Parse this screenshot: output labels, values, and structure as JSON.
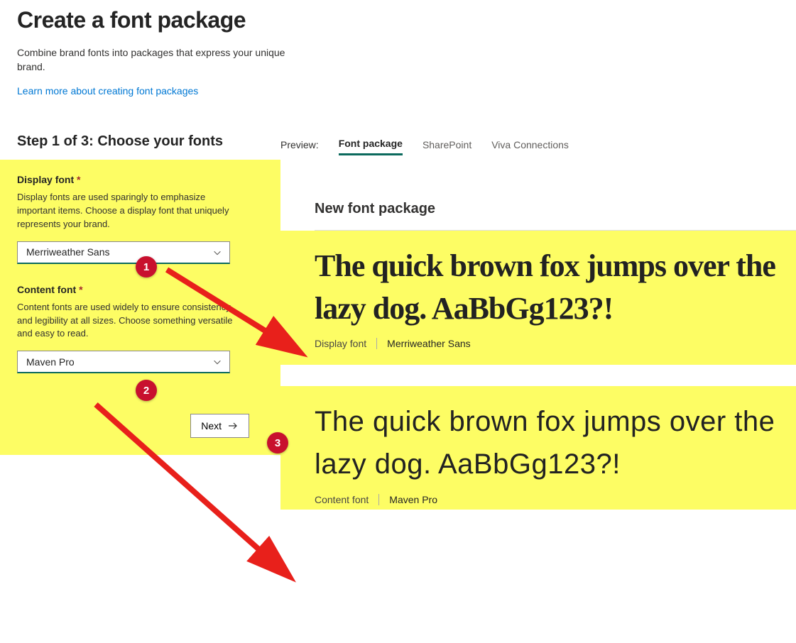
{
  "header": {
    "title": "Create a font package",
    "description": "Combine brand fonts into packages that express your unique brand.",
    "learn_link": "Learn more about creating font packages"
  },
  "step": {
    "title": "Step 1 of 3: Choose your fonts"
  },
  "form": {
    "display_font": {
      "label": "Display font",
      "required_mark": "*",
      "help": "Display fonts are used sparingly to emphasize important items. Choose a display font that uniquely represents your brand.",
      "value": "Merriweather Sans"
    },
    "content_font": {
      "label": "Content font",
      "required_mark": "*",
      "help": "Content fonts are used widely to ensure consistency and legibility at all sizes. Choose something versatile and easy to read.",
      "value": "Maven Pro"
    },
    "next_label": "Next"
  },
  "preview": {
    "label": "Preview:",
    "tabs": {
      "font_package": "Font package",
      "sharepoint": "SharePoint",
      "viva": "Viva Connections"
    },
    "card_title": "New font package",
    "sample_text": "The quick brown fox jumps over the lazy dog. AaBbGg123?!",
    "display_meta_label": "Display font",
    "display_meta_value": "Merriweather Sans",
    "content_meta_label": "Content font",
    "content_meta_value": "Maven Pro"
  },
  "annotations": {
    "badge1": "1",
    "badge2": "2",
    "badge3": "3"
  },
  "colors": {
    "highlight": "#fdfd64",
    "accent": "#0b6a5d",
    "link": "#0078d4",
    "badge": "#c8102e"
  }
}
